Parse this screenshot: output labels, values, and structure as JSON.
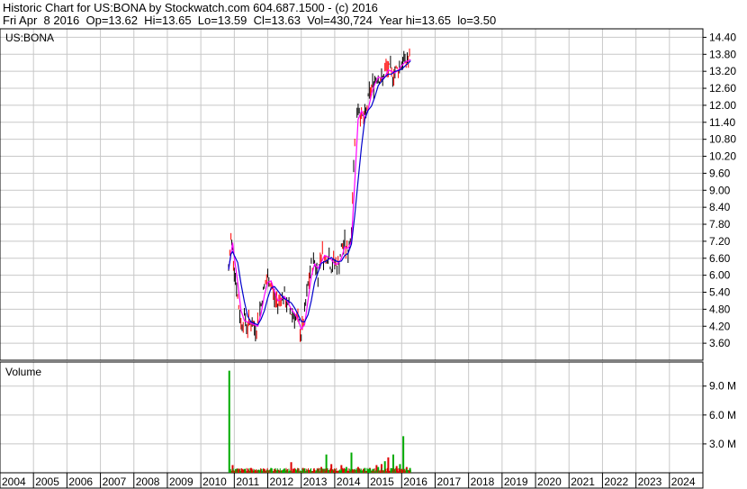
{
  "header": {
    "line1": "Historic Chart for US:BONA by Stockwatch.com 604.687.1500 - (c) 2016",
    "line2": "Fri Apr  8 2016  Op=13.62  Hi=13.65  Lo=13.59  Cl=13.63  Vol=430,724  Year hi=13.65  lo=3.50"
  },
  "colors": {
    "grid": "#c8c8c8",
    "price": "#000000",
    "price_alt": "#ff0000",
    "ma_short": "#ff00ff",
    "ma_long": "#0000cc",
    "vol_up": "#00aa00",
    "vol_down": "#dd0000"
  },
  "chart_data": [
    {
      "type": "line",
      "title": "US:BONA",
      "ylim": [
        3.0,
        14.7
      ],
      "yticks": [
        "14.40",
        "13.80",
        "13.20",
        "12.60",
        "12.00",
        "11.40",
        "10.80",
        "10.20",
        "9.60",
        "9.00",
        "8.40",
        "7.80",
        "7.20",
        "6.60",
        "6.00",
        "5.40",
        "4.80",
        "4.20",
        "3.60"
      ],
      "x_categories": [
        "2004",
        "2005",
        "2006",
        "2007",
        "2008",
        "2009",
        "2010",
        "2011",
        "2012",
        "2013",
        "2014",
        "2015",
        "2016",
        "2017",
        "2018",
        "2019",
        "2020",
        "2021",
        "2022",
        "2023",
        "2024"
      ],
      "series": [
        {
          "x": [
            2010.83,
            2010.9,
            2010.95,
            2011.0,
            2011.1,
            2011.2,
            2011.3,
            2011.4,
            2011.5,
            2011.6,
            2011.7,
            2011.8,
            2011.9,
            2012.0,
            2012.1,
            2012.2,
            2012.3,
            2012.4,
            2012.5,
            2012.6,
            2012.7,
            2012.8,
            2012.9,
            2013.0,
            2013.1,
            2013.2,
            2013.3,
            2013.4,
            2013.5,
            2013.6,
            2013.7,
            2013.8,
            2013.9,
            2014.0,
            2014.1,
            2014.2,
            2014.3,
            2014.4,
            2014.5,
            2014.6,
            2014.7,
            2014.8,
            2014.9,
            2015.0,
            2015.1,
            2015.2,
            2015.3,
            2015.4,
            2015.5,
            2015.6,
            2015.7,
            2015.8,
            2015.9,
            2016.0,
            2016.1,
            2016.2,
            2016.27
          ],
          "y": [
            6.2,
            7.3,
            7.0,
            6.3,
            5.2,
            4.3,
            4.5,
            4.2,
            4.4,
            4.1,
            4.3,
            5.0,
            5.6,
            5.9,
            5.7,
            5.2,
            5.0,
            5.3,
            5.2,
            4.9,
            4.7,
            4.6,
            4.3,
            3.9,
            4.6,
            5.6,
            6.3,
            6.5,
            6.0,
            6.9,
            6.5,
            6.8,
            6.3,
            6.5,
            6.3,
            6.9,
            7.1,
            6.8,
            7.6,
            11.0,
            12.0,
            11.6,
            11.5,
            12.2,
            12.6,
            12.9,
            13.1,
            12.8,
            13.2,
            13.3,
            13.1,
            13.2,
            13.3,
            13.5,
            13.55,
            13.6,
            13.63
          ]
        }
      ]
    },
    {
      "type": "bar",
      "title": "Volume",
      "ylim": [
        0,
        11.5
      ],
      "yticks": [
        "9.0 M",
        "6.0 M",
        "3.0 M"
      ],
      "series": [
        {
          "x": [
            2010.85,
            2010.95,
            2011.1,
            2011.3,
            2011.5,
            2011.7,
            2011.9,
            2012.1,
            2012.3,
            2012.5,
            2012.7,
            2012.9,
            2013.05,
            2013.2,
            2013.4,
            2013.5,
            2013.6,
            2013.75,
            2013.9,
            2014.0,
            2014.2,
            2014.35,
            2014.5,
            2014.7,
            2014.9,
            2015.05,
            2015.15,
            2015.25,
            2015.3,
            2015.4,
            2015.5,
            2015.6,
            2015.75,
            2015.85,
            2015.95,
            2016.05,
            2016.15,
            2016.25
          ],
          "y": [
            10.6,
            0.8,
            0.4,
            0.4,
            0.5,
            0.3,
            0.4,
            0.5,
            0.3,
            0.4,
            1.1,
            0.3,
            0.5,
            0.3,
            0.3,
            0.4,
            0.6,
            1.9,
            0.9,
            0.4,
            0.8,
            0.6,
            2.1,
            0.6,
            0.5,
            0.5,
            0.4,
            0.8,
            0.6,
            0.9,
            1.2,
            1.6,
            1.9,
            0.7,
            0.9,
            3.8,
            0.6,
            0.5
          ],
          "up": [
            true,
            false,
            false,
            true,
            false,
            true,
            false,
            true,
            false,
            true,
            false,
            true,
            false,
            true,
            false,
            true,
            false,
            true,
            false,
            true,
            false,
            true,
            true,
            false,
            true,
            false,
            true,
            false,
            true,
            false,
            true,
            false,
            true,
            false,
            true,
            true,
            false,
            true
          ]
        }
      ]
    }
  ]
}
